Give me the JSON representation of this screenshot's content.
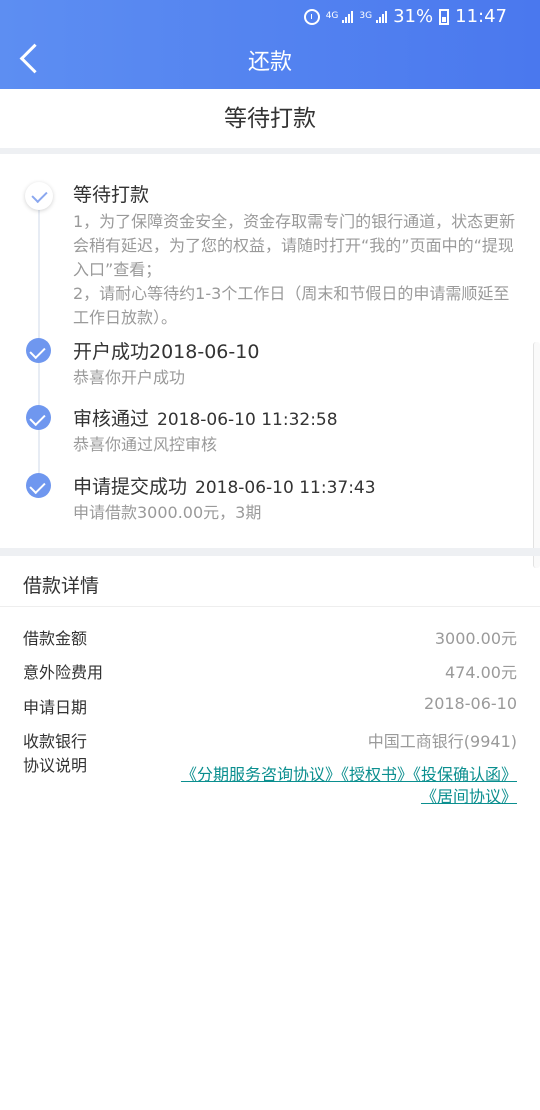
{
  "status_bar": {
    "network_top": "4G",
    "network_bottom": "3G",
    "battery": "31%",
    "time": "11:47"
  },
  "header": {
    "title": "还款"
  },
  "subheader": {
    "title": "等待打款"
  },
  "steps": [
    {
      "title": "等待打款",
      "time": "",
      "description": "1，为了保障资金安全，资金存取需专门的银行通道，状态更新会稍有延迟，为了您的权益，请随时打开“我的”页面中的“提现入口”查看；\n2，请耐心等待约1-3个工作日（周末和节假日的申请需顺延至工作日放款）。"
    },
    {
      "title": "开户成功2018-06-10",
      "time": "",
      "description": "恭喜你开户成功"
    },
    {
      "title": "审核通过",
      "time": "2018-06-10 11:32:58",
      "description": "恭喜你通过风控审核"
    },
    {
      "title": "申请提交成功",
      "time": "2018-06-10 11:37:43",
      "description": "申请借款3000.00元，3期"
    }
  ],
  "details": {
    "title": "借款详情",
    "rows": [
      {
        "label": "借款金额",
        "value": "3000.00元"
      },
      {
        "label": "意外险费用",
        "value": "474.00元"
      },
      {
        "label": "申请日期",
        "value": "2018-06-10"
      },
      {
        "label": "收款银行",
        "value": "中国工商银行(9941)"
      },
      {
        "label": "协议说明",
        "value": ""
      }
    ],
    "agreements": [
      "《分期服务咨询协议》",
      "《授权书》",
      "《投保确认函》",
      "《居间协议》"
    ]
  }
}
